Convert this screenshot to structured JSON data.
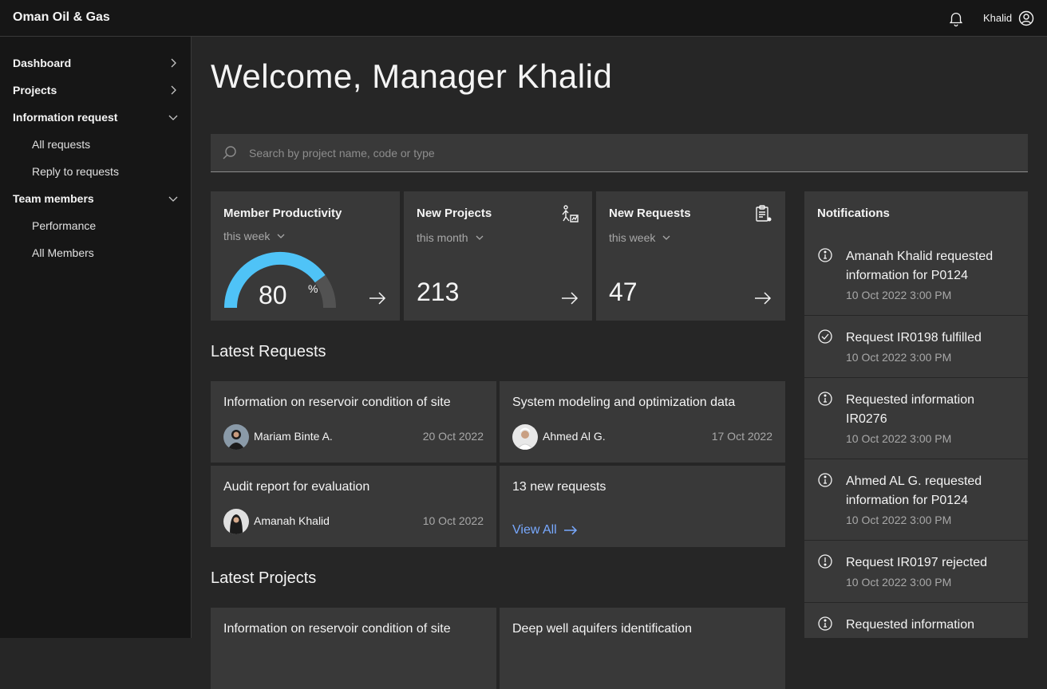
{
  "header": {
    "brand": "Oman Oil & Gas",
    "user_name": "Khalid",
    "bell_icon": "bell-icon",
    "avatar_icon": "user-avatar-icon"
  },
  "sidenav": {
    "items": [
      {
        "label": "Dashboard",
        "icon": "chevron-right-icon"
      },
      {
        "label": "Projects",
        "icon": "chevron-right-icon"
      },
      {
        "label": "Information request",
        "icon": "chevron-down-icon",
        "children": [
          "All requests",
          "Reply to requests"
        ]
      },
      {
        "label": "Team members",
        "icon": "chevron-down-icon",
        "children": [
          "Performance",
          "All Members"
        ]
      }
    ]
  },
  "main": {
    "welcome": "Welcome, Manager Khalid",
    "search_placeholder": "Search by project name, code or type"
  },
  "tiles": {
    "productivity": {
      "title": "Member Productivity",
      "period": "this week",
      "value": "80",
      "unit": "%",
      "gauge_fraction": 0.8
    },
    "projects": {
      "title": "New Projects",
      "period": "this month",
      "value": "213"
    },
    "requests": {
      "title": "New Requests",
      "period": "this week",
      "value": "47"
    }
  },
  "latest_requests": {
    "title": "Latest Requests",
    "cards": [
      {
        "title": "Information on reservoir condition of site",
        "author": "Mariam Binte A.",
        "date": "20 Oct 2022"
      },
      {
        "title": "System modeling and optimization data",
        "author": "Ahmed Al G.",
        "date": "17 Oct 2022"
      },
      {
        "title": "Audit report for evaluation",
        "author": "Amanah Khalid",
        "date": "10 Oct 2022"
      },
      {
        "title": "13 new requests",
        "link": "View All"
      }
    ]
  },
  "latest_projects": {
    "title": "Latest Projects",
    "cards": [
      {
        "title": "Information on reservoir condition of site"
      },
      {
        "title": "Deep well aquifers identification"
      }
    ]
  },
  "notifications": {
    "title": "Notifications",
    "items": [
      {
        "icon": "info-icon",
        "text": "Amanah Khalid requested information for P0124",
        "time": "10 Oct 2022 3:00 PM"
      },
      {
        "icon": "checkmark-icon",
        "text": "Request IR0198 fulfilled",
        "time": "10 Oct 2022 3:00 PM"
      },
      {
        "icon": "info-icon",
        "text": "Requested information IR0276",
        "time": "10 Oct 2022 3:00 PM"
      },
      {
        "icon": "info-icon",
        "text": "Ahmed AL G. requested information for P0124",
        "time": "10 Oct 2022 3:00 PM"
      },
      {
        "icon": "warning-icon",
        "text": "Request IR0197 rejected",
        "time": "10 Oct 2022 3:00 PM"
      },
      {
        "icon": "info-icon",
        "text": "Requested information",
        "time": ""
      }
    ]
  },
  "colors": {
    "accent_blue": "#4fc3f7",
    "link_blue": "#78a9ff",
    "tile_bg": "#393939",
    "page_bg": "#262626",
    "nav_bg": "#161616"
  }
}
